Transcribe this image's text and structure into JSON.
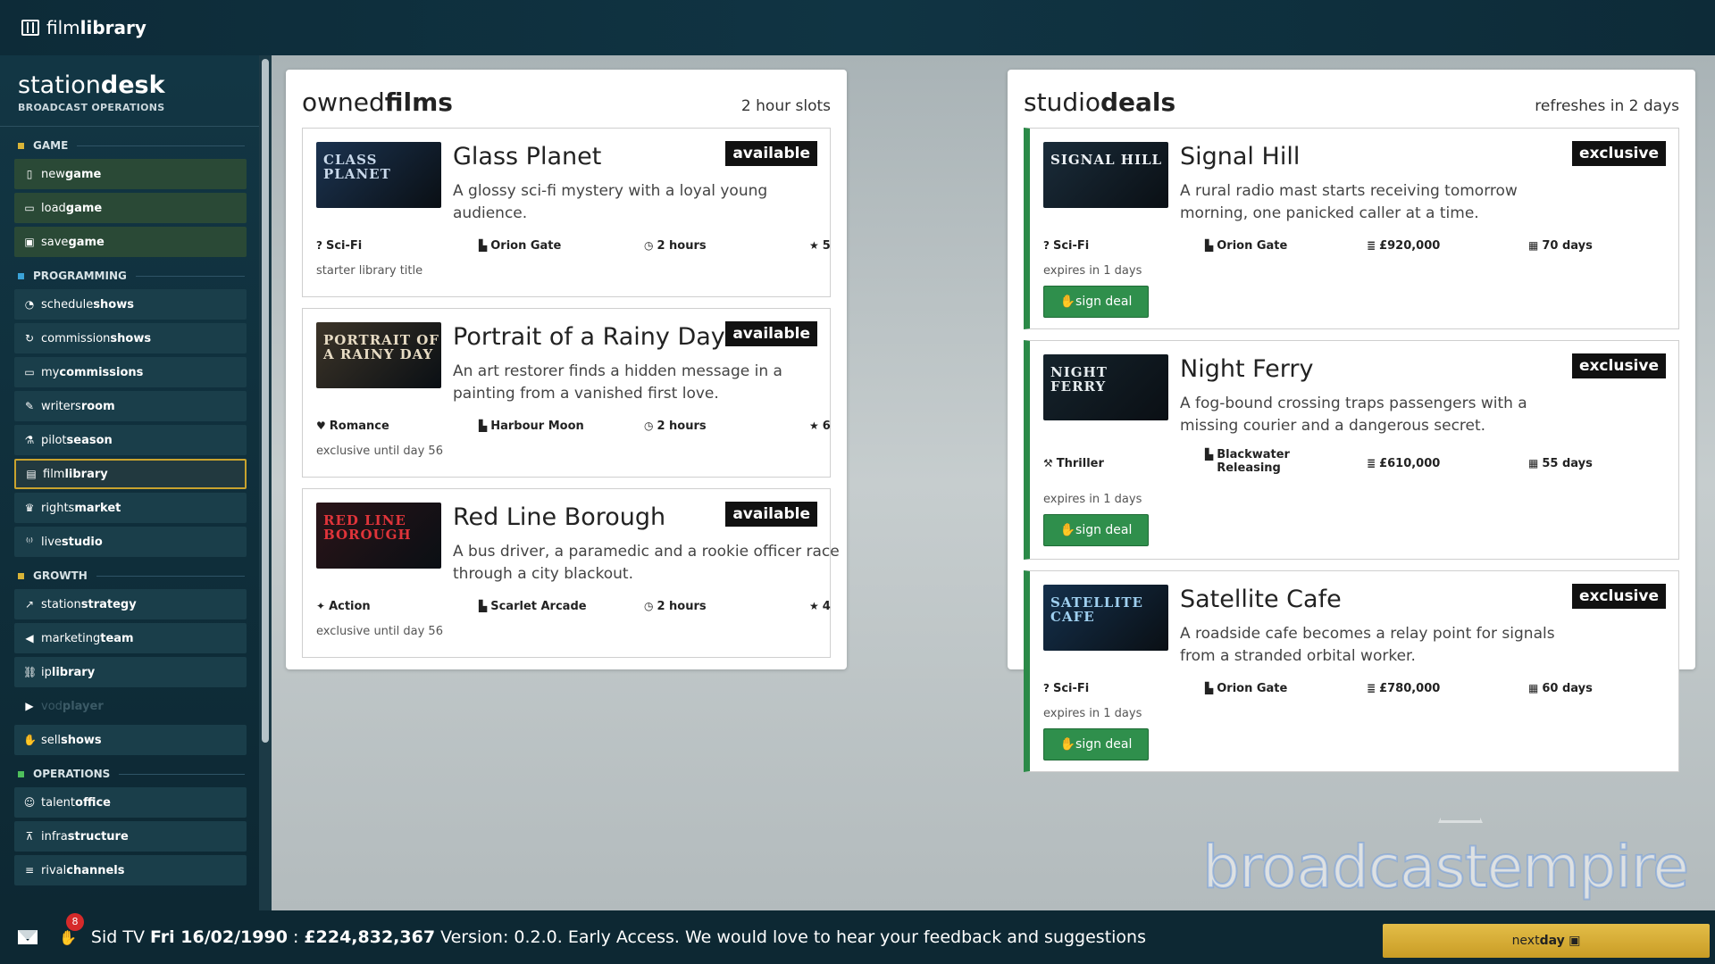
{
  "app": {
    "brand_prefix": "film",
    "brand_bold": "library"
  },
  "sidebar": {
    "title_prefix": "station",
    "title_bold": "desk",
    "subtitle": "BROADCAST OPERATIONS",
    "sections": [
      {
        "title": "GAME",
        "color": "#d8b438",
        "items": [
          {
            "icon": "new-file-icon",
            "glyph": "▯",
            "prefix": "new",
            "bold": "game",
            "style": "game"
          },
          {
            "icon": "folder-icon",
            "glyph": "▭",
            "prefix": "load",
            "bold": "game",
            "style": "game"
          },
          {
            "icon": "save-icon",
            "glyph": "▣",
            "prefix": "save",
            "bold": "game",
            "style": "game"
          }
        ]
      },
      {
        "title": "PROGRAMMING",
        "color": "#3aa3d8",
        "items": [
          {
            "icon": "clock-icon",
            "glyph": "◔",
            "prefix": "schedule",
            "bold": "shows",
            "style": ""
          },
          {
            "icon": "refresh-icon",
            "glyph": "↻",
            "prefix": "commission",
            "bold": "shows",
            "style": ""
          },
          {
            "icon": "monitor-icon",
            "glyph": "▭",
            "prefix": "my",
            "bold": "commissions",
            "style": ""
          },
          {
            "icon": "pen-icon",
            "glyph": "✎",
            "prefix": "writers",
            "bold": "room",
            "style": ""
          },
          {
            "icon": "flask-icon",
            "glyph": "⚗",
            "prefix": "pilot",
            "bold": "season",
            "style": ""
          },
          {
            "icon": "film-icon",
            "glyph": "▤",
            "prefix": "film",
            "bold": "library",
            "style": "active"
          },
          {
            "icon": "trophy-icon",
            "glyph": "♛",
            "prefix": "rights",
            "bold": "market",
            "style": ""
          },
          {
            "icon": "broadcast-icon",
            "glyph": "⁽ᵎ⁾",
            "prefix": "live",
            "bold": "studio",
            "style": ""
          }
        ]
      },
      {
        "title": "GROWTH",
        "color": "#d8b438",
        "items": [
          {
            "icon": "chart-icon",
            "glyph": "↗",
            "prefix": "station",
            "bold": "strategy",
            "style": ""
          },
          {
            "icon": "megaphone-icon",
            "glyph": "◀",
            "prefix": "marketing",
            "bold": "team",
            "style": ""
          },
          {
            "icon": "network-icon",
            "glyph": "⛓",
            "prefix": "ip",
            "bold": "library",
            "style": ""
          },
          {
            "icon": "play-icon",
            "glyph": "▶",
            "prefix": "vod",
            "bold": "player",
            "style": "dim"
          },
          {
            "icon": "handshake-icon",
            "glyph": "✋",
            "prefix": "sell",
            "bold": "shows",
            "style": ""
          }
        ]
      },
      {
        "title": "OPERATIONS",
        "color": "#4fbf5c",
        "items": [
          {
            "icon": "people-icon",
            "glyph": "☺",
            "prefix": "talent",
            "bold": "office",
            "style": ""
          },
          {
            "icon": "tower-icon",
            "glyph": "⊼",
            "prefix": "infra",
            "bold": "structure",
            "style": ""
          },
          {
            "icon": "ranking-icon",
            "glyph": "≡",
            "prefix": "rival",
            "bold": "channels",
            "style": ""
          }
        ]
      }
    ]
  },
  "owned": {
    "title_prefix": "owned",
    "title_bold": "films",
    "meta": "2 hour slots",
    "films": [
      {
        "title": "Glass Planet",
        "desc": "A glossy sci-fi mystery with a loyal young audience.",
        "badge": "available",
        "poster": "CLASS PLANET",
        "poster_bg": "#1b3350",
        "poster_fg": "#c8d8ea",
        "genre": "Sci-Fi",
        "genre_icon": "question-circle-icon",
        "genre_glyph": "?",
        "studio": "Orion Gate",
        "duration": "2 hours",
        "rating": "5",
        "note": "starter library title"
      },
      {
        "title": "Portrait of a Rainy Day",
        "desc": "An art restorer finds a hidden message in a painting from a vanished first love.",
        "badge": "available",
        "poster": "PORTRAIT OF A RAINY DAY",
        "poster_bg": "#3c3428",
        "poster_fg": "#e8dcc4",
        "genre": "Romance",
        "genre_icon": "heart-circle-icon",
        "genre_glyph": "♥",
        "studio": "Harbour Moon",
        "duration": "2 hours",
        "rating": "6",
        "note": "exclusive until day 56"
      },
      {
        "title": "Red Line Borough",
        "desc": "A bus driver, a paramedic and a rookie officer race through a city blackout.",
        "badge": "available",
        "poster": "RED LINE BOROUGH",
        "poster_bg": "#2a1418",
        "poster_fg": "#e0343a",
        "genre": "Action",
        "genre_icon": "running-icon",
        "genre_glyph": "✦",
        "studio": "Scarlet Arcade",
        "duration": "2 hours",
        "rating": "4",
        "note": "exclusive until day 56"
      }
    ]
  },
  "deals": {
    "title_prefix": "studio",
    "title_bold": "deals",
    "meta": "refreshes in 2 days",
    "sign_label": "sign deal",
    "items": [
      {
        "title": "Signal Hill",
        "desc": "A rural radio mast starts receiving tomorrow morning, one panicked caller at a time.",
        "badge": "exclusive",
        "poster": "SIGNAL HILL",
        "poster_bg": "#1a2c3a",
        "poster_fg": "#eef2f6",
        "genre": "Sci-Fi",
        "genre_icon": "question-circle-icon",
        "genre_glyph": "?",
        "studio": "Orion Gate",
        "price": "£920,000",
        "term": "70 days",
        "note": "expires in 1 days"
      },
      {
        "title": "Night Ferry",
        "desc": "A fog-bound crossing traps passengers with a missing courier and a dangerous secret.",
        "badge": "exclusive",
        "poster": "NIGHT FERRY",
        "poster_bg": "#15232c",
        "poster_fg": "#e6ecef",
        "genre": "Thriller",
        "genre_icon": "hammer-icon",
        "genre_glyph": "⚒",
        "studio": "Blackwater Releasing",
        "price": "£610,000",
        "term": "55 days",
        "note": "expires in 1 days"
      },
      {
        "title": "Satellite Cafe",
        "desc": "A roadside cafe becomes a relay point for signals from a stranded orbital worker.",
        "badge": "exclusive",
        "poster": "SATELLITE CAFE",
        "poster_bg": "#14304c",
        "poster_fg": "#9fd0f0",
        "genre": "Sci-Fi",
        "genre_icon": "question-circle-icon",
        "genre_glyph": "?",
        "studio": "Orion Gate",
        "price": "£780,000",
        "term": "60 days",
        "note": "expires in 1 days"
      }
    ]
  },
  "watermark": "broadcastempire",
  "footer": {
    "deal_count": "8",
    "station": "Sid TV",
    "date": "Fri 16/02/1990",
    "money": "£224,832,367",
    "message": "Version: 0.2.0. Early Access. We would love to hear your feedback and suggestions",
    "next_prefix": "next",
    "next_bold": "day"
  }
}
